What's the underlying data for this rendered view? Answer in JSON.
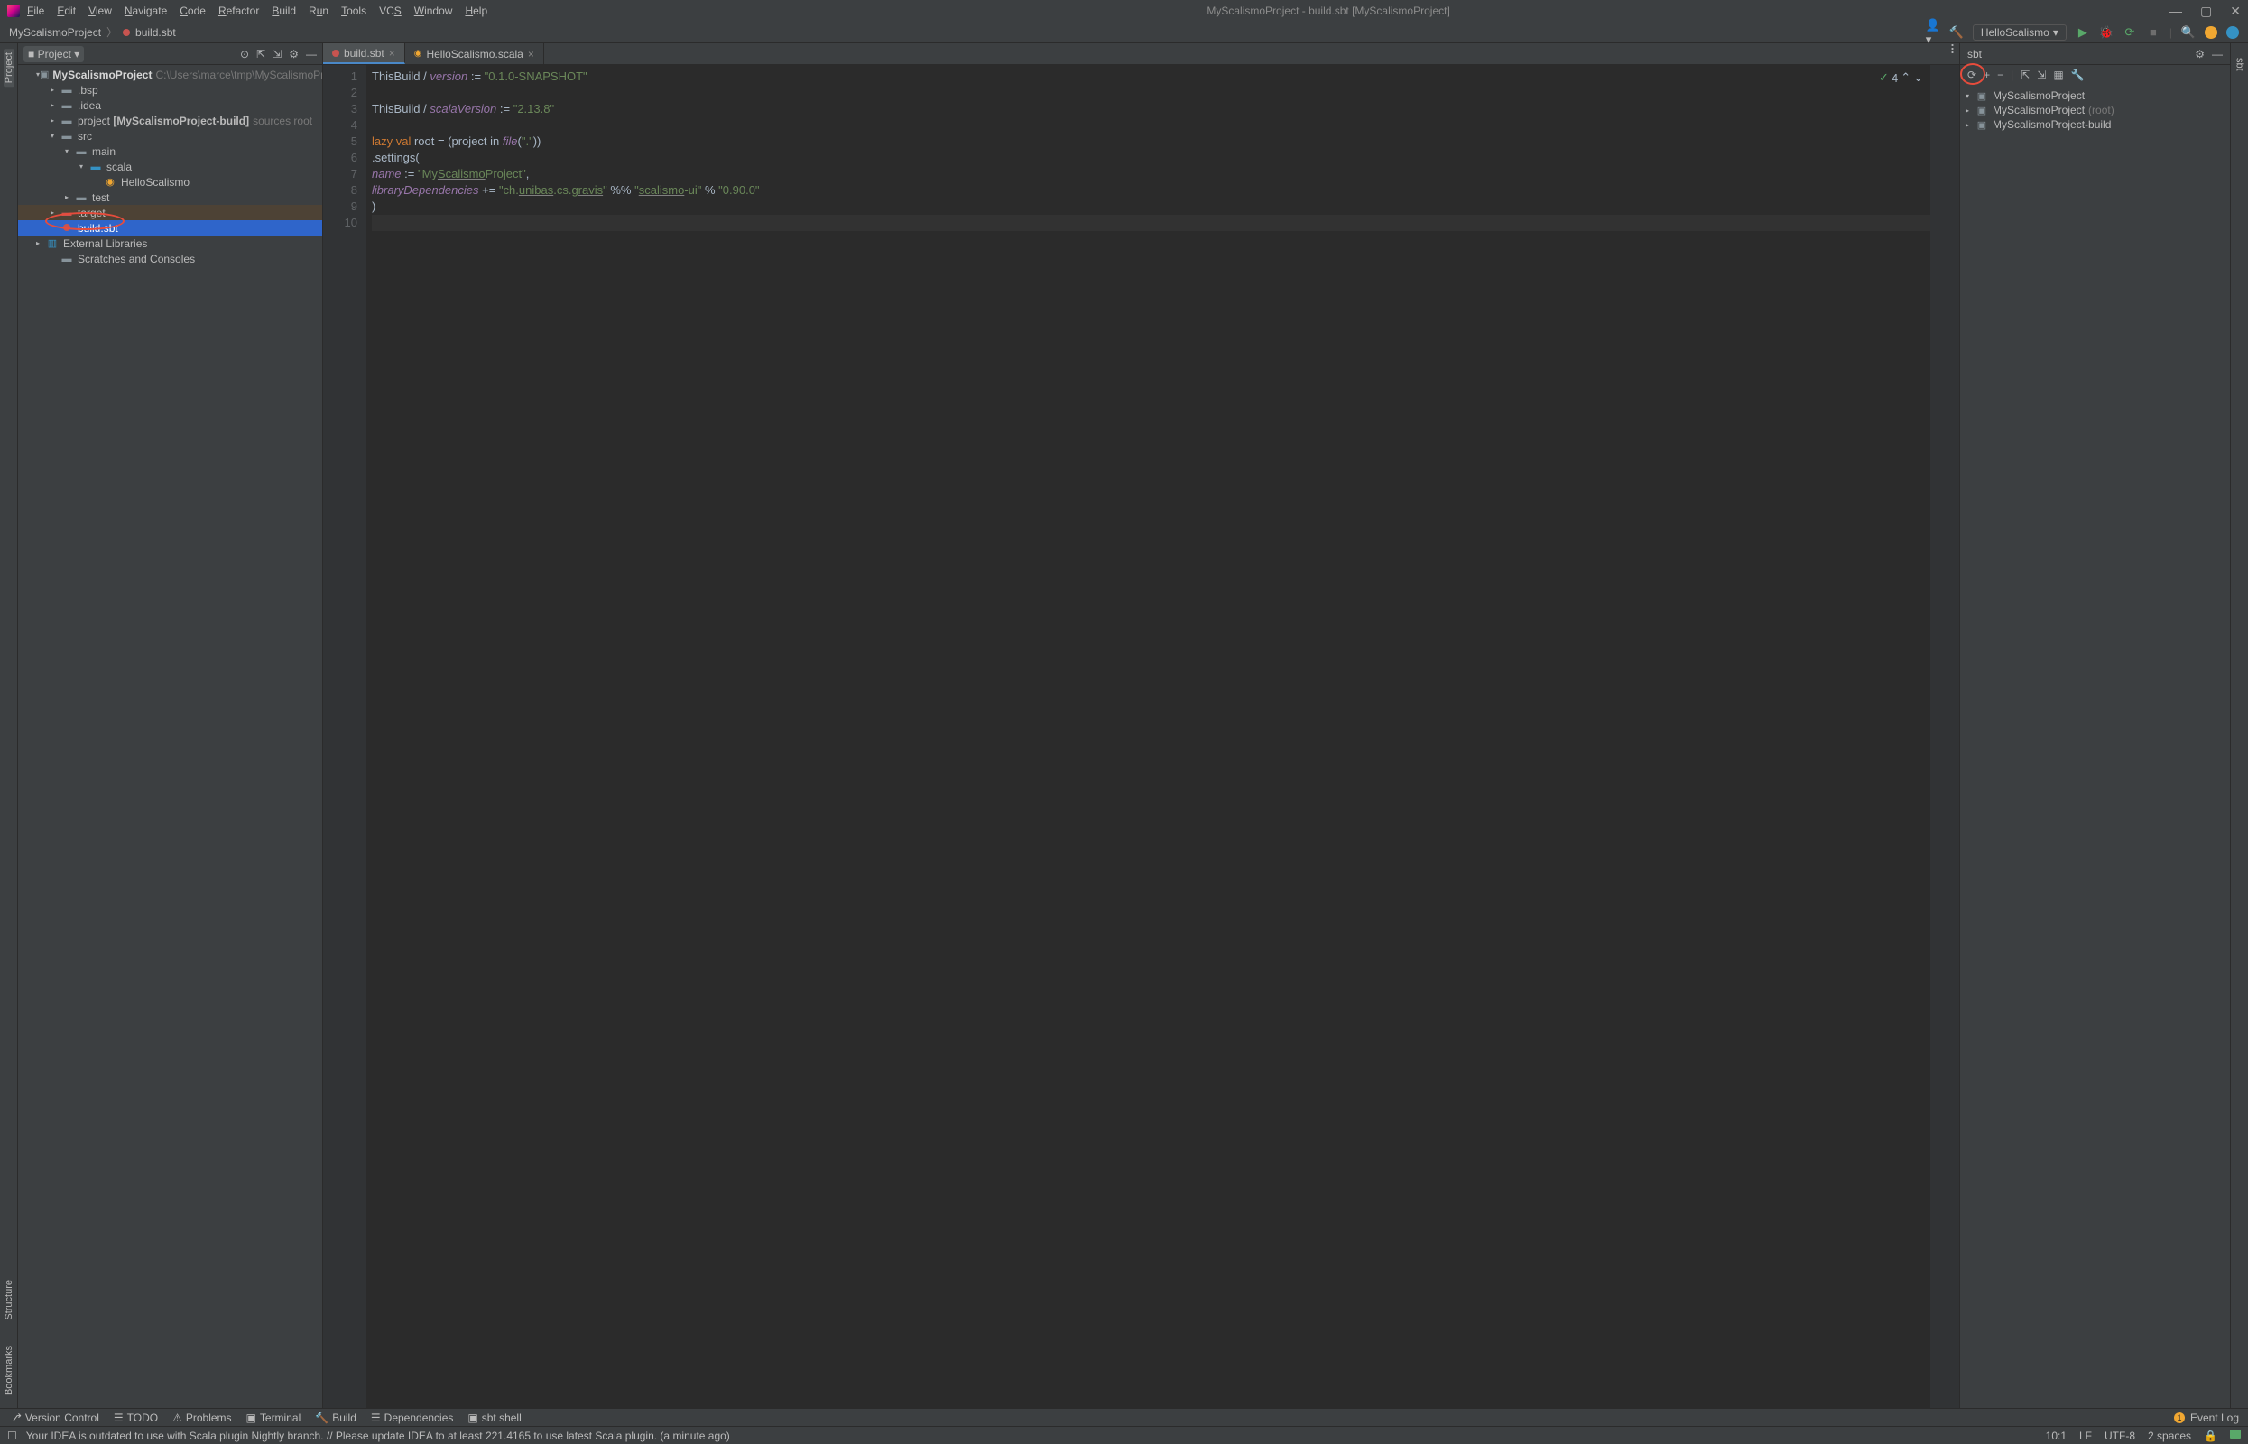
{
  "title": "MyScalismoProject - build.sbt [MyScalismoProject]",
  "menu": [
    "File",
    "Edit",
    "View",
    "Navigate",
    "Code",
    "Refactor",
    "Build",
    "Run",
    "Tools",
    "VCS",
    "Window",
    "Help"
  ],
  "breadcrumb": {
    "root": "MyScalismoProject",
    "file": "build.sbt"
  },
  "runConfig": "HelloScalismo",
  "projectPanel": {
    "title": "Project",
    "tree": {
      "root": "MyScalismoProject",
      "rootPath": "C:\\Users\\marce\\tmp\\MyScalismoProject",
      "bsp": ".bsp",
      "idea": ".idea",
      "project": "project",
      "projectModule": "[MyScalismoProject-build]",
      "sourcesRoot": "sources root",
      "src": "src",
      "main": "main",
      "scala": "scala",
      "helloScalismo": "HelloScalismo",
      "test": "test",
      "target": "target",
      "buildSbt": "build.sbt",
      "externalLibs": "External Libraries",
      "scratches": "Scratches and Consoles"
    }
  },
  "tabs": {
    "buildSbt": "build.sbt",
    "helloScalismo": "HelloScalismo.scala"
  },
  "code": {
    "l1a": "ThisBuild / ",
    "l1b": "version",
    "l1c": " := ",
    "l1d": "\"0.1.0-SNAPSHOT\"",
    "l3a": "ThisBuild / ",
    "l3b": "scalaVersion",
    "l3c": " := ",
    "l3d": "\"2.13.8\"",
    "l5a": "lazy val ",
    "l5b": "root = (project in ",
    "l5c": "file",
    "l5d": "(",
    "l5e": "\".\"",
    "l5f": "))",
    "l6a": "  .settings(",
    "l7a": "    ",
    "l7b": "name",
    "l7c": " := ",
    "l7d": "\"My",
    "l7e": "Scalismo",
    "l7f": "Project\"",
    "l7g": ",",
    "l8a": "    ",
    "l8b": "libraryDependencies",
    "l8c": " += ",
    "l8d": "\"ch.",
    "l8e": "unibas",
    "l8f": ".cs.",
    "l8g": "gravis",
    "l8h": "\"",
    "l8i": " %% ",
    "l8j": "\"",
    "l8k": "scalismo",
    "l8l": "-ui\"",
    "l8m": " % ",
    "l8n": "\"0.90.0\"",
    "l9a": "  )"
  },
  "lineNumbers": [
    "1",
    "2",
    "3",
    "4",
    "5",
    "6",
    "7",
    "8",
    "9",
    "10"
  ],
  "problems": {
    "warnings": "4"
  },
  "sbtPanel": {
    "title": "sbt",
    "root": "MyScalismoProject",
    "node1": "MyScalismoProject",
    "node1Hint": "(root)",
    "node2": "MyScalismoProject-build"
  },
  "bottomTools": {
    "versionControl": "Version Control",
    "todo": "TODO",
    "problems": "Problems",
    "terminal": "Terminal",
    "build": "Build",
    "dependencies": "Dependencies",
    "sbtShell": "sbt shell",
    "eventLog": "Event Log",
    "eventLogCount": "1"
  },
  "statusbar": {
    "message": "Your IDEA is outdated to use with Scala plugin Nightly branch. // Please update IDEA to at least 221.4165 to use latest Scala plugin. (a minute ago)",
    "position": "10:1",
    "lf": "LF",
    "encoding": "UTF-8",
    "indent": "2 spaces"
  },
  "leftGutter": {
    "project": "Project",
    "structure": "Structure",
    "bookmarks": "Bookmarks"
  },
  "rightGutter": {
    "sbt": "sbt"
  }
}
